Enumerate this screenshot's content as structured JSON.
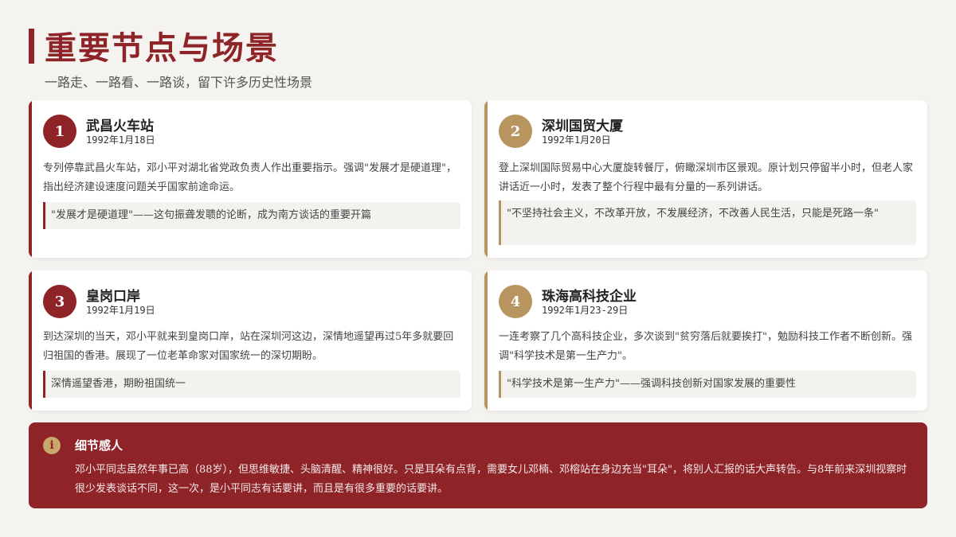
{
  "header": {
    "title": "重要节点与场景",
    "subtitle": "一路走、一路看、一路谈，留下许多历史性场景"
  },
  "colors": {
    "accent_red": "#8e2328",
    "accent_gold": "#b8955f",
    "background": "#f4f3ef"
  },
  "cards": [
    {
      "number": "1",
      "title": "武昌火车站",
      "date": "1992年1月18日",
      "body": "专列停靠武昌火车站，邓小平对湖北省党政负责人作出重要指示。强调\"发展才是硬道理\"，指出经济建设速度问题关乎国家前途命运。",
      "quote": "\"发展才是硬道理\"——这句振聋发聩的论断，成为南方谈话的重要开篇"
    },
    {
      "number": "2",
      "title": "深圳国贸大厦",
      "date": "1992年1月20日",
      "body": "登上深圳国际贸易中心大厦旋转餐厅，俯瞰深圳市区景观。原计划只停留半小时，但老人家讲话近一小时，发表了整个行程中最有分量的一系列讲话。",
      "quote": "\"不坚持社会主义，不改革开放，不发展经济，不改善人民生活，只能是死路一条\""
    },
    {
      "number": "3",
      "title": "皇岗口岸",
      "date": "1992年1月19日",
      "body": "到达深圳的当天，邓小平就来到皇岗口岸，站在深圳河这边，深情地遥望再过5年多就要回归祖国的香港。展现了一位老革命家对国家统一的深切期盼。",
      "quote": "深情遥望香港，期盼祖国统一"
    },
    {
      "number": "4",
      "title": "珠海高科技企业",
      "date": "1992年1月23-29日",
      "body": "一连考察了几个高科技企业，多次谈到\"贫穷落后就要挨打\"，勉励科技工作者不断创新。强调\"科学技术是第一生产力\"。",
      "quote": "\"科学技术是第一生产力\"——强调科技创新对国家发展的重要性"
    }
  ],
  "detail": {
    "icon": "info-icon",
    "icon_glyph": "i",
    "title": "细节感人",
    "text": "邓小平同志虽然年事已高（88岁），但思维敏捷、头脑清醒、精神很好。只是耳朵有点背，需要女儿邓楠、邓榕站在身边充当\"耳朵\"，将别人汇报的话大声转告。与8年前来深圳视察时很少发表谈话不同，这一次，是小平同志有话要讲，而且是有很多重要的话要讲。"
  }
}
